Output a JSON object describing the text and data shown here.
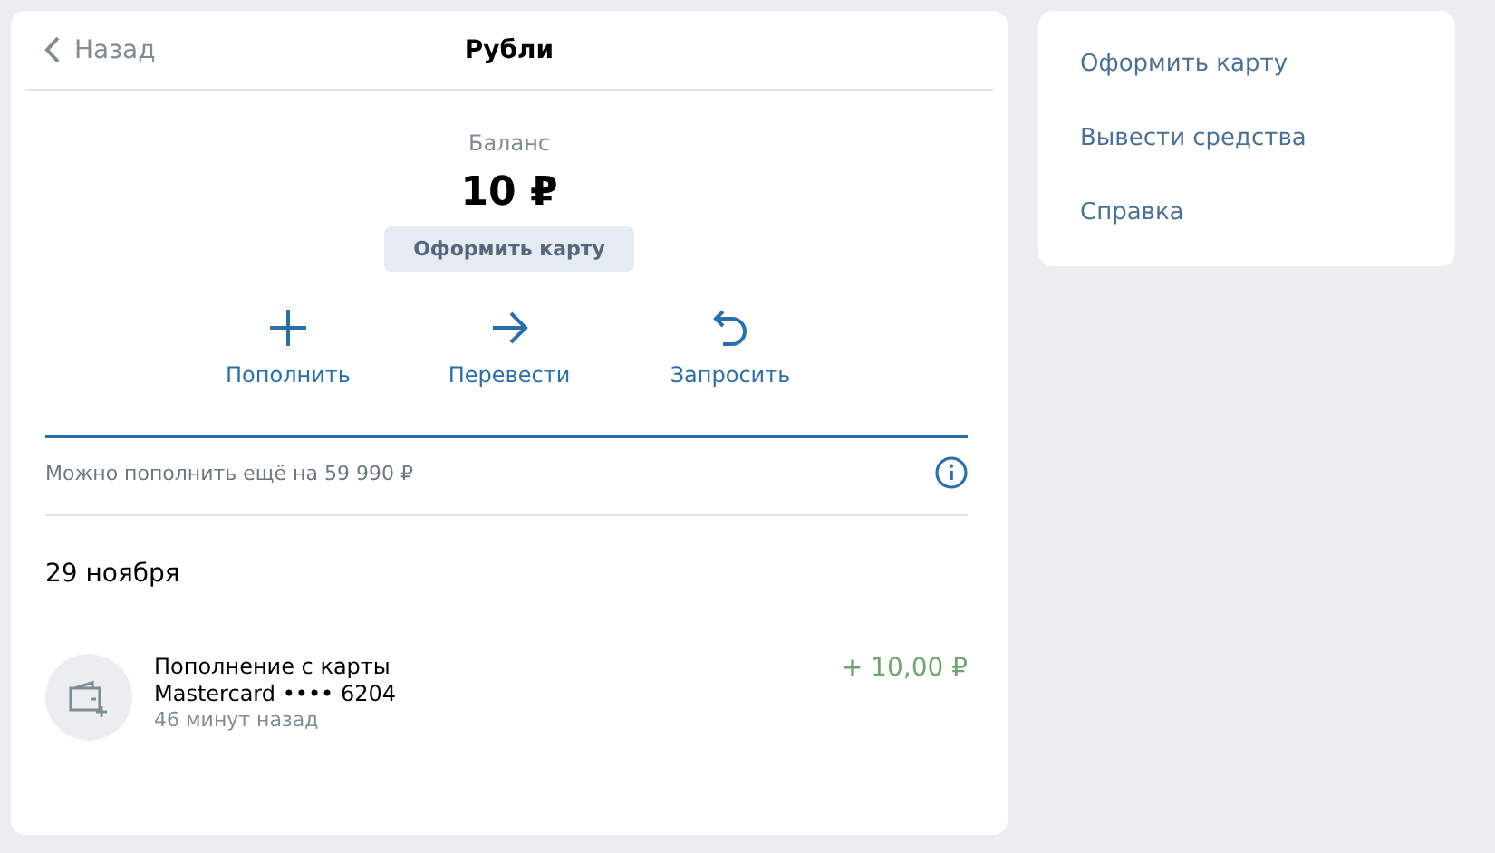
{
  "header": {
    "back_label": "Назад",
    "title": "Рубли"
  },
  "balance": {
    "label": "Баланс",
    "amount": "10 ₽",
    "card_button": "Оформить карту"
  },
  "actions": [
    {
      "kind": "plus",
      "label": "Пополнить"
    },
    {
      "kind": "arrow",
      "label": "Перевести"
    },
    {
      "kind": "undo",
      "label": "Запросить"
    }
  ],
  "limit_text": "Можно пополнить ещё на 59 990 ₽",
  "history": [
    {
      "date": "29 ноября",
      "transactions": [
        {
          "title": "Пополнение с карты",
          "card": "Mastercard •••• 6204",
          "time": "46 минут назад",
          "amount": "+ 10,00 ₽"
        }
      ]
    }
  ],
  "side_menu": {
    "items": [
      "Оформить карту",
      "Вывести средства",
      "Справка"
    ]
  }
}
